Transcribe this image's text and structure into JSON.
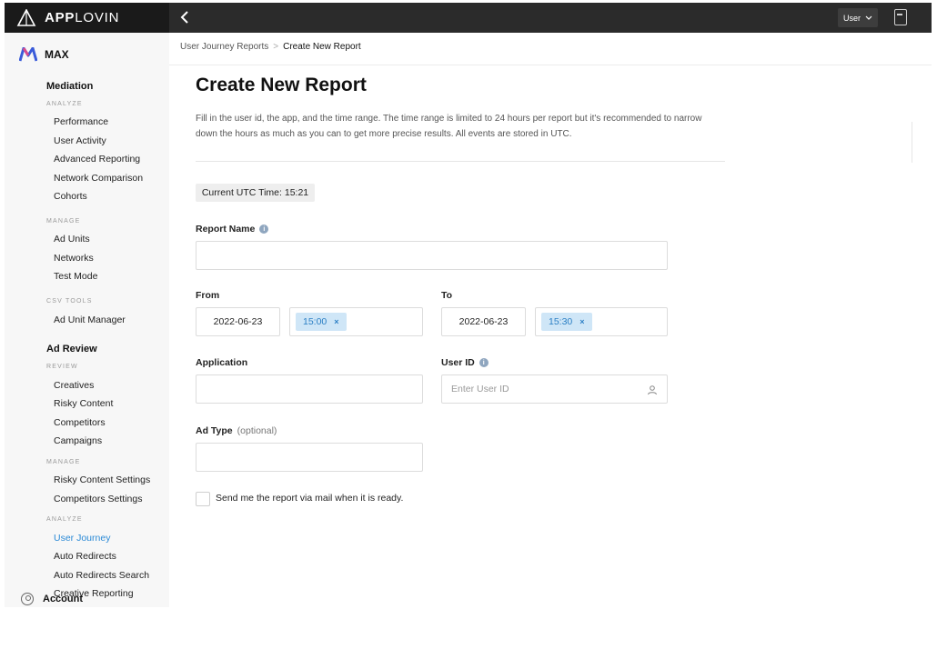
{
  "brand": {
    "name_bold": "APP",
    "name_rest": "LOVIN"
  },
  "topbar": {
    "user_label": "User"
  },
  "sidebar": {
    "product": "MAX",
    "mediation": {
      "title": "Mediation",
      "analyze_label": "ANALYZE",
      "analyze": [
        "Performance",
        "User Activity",
        "Advanced Reporting",
        "Network Comparison",
        "Cohorts"
      ],
      "manage_label": "MANAGE",
      "manage": [
        "Ad Units",
        "Networks",
        "Test Mode"
      ],
      "csv_label": "CSV TOOLS",
      "csv": [
        "Ad Unit Manager"
      ]
    },
    "ad_review": {
      "title": "Ad Review",
      "review_label": "REVIEW",
      "review": [
        "Creatives",
        "Risky Content",
        "Competitors",
        "Campaigns"
      ],
      "manage_label": "MANAGE",
      "manage": [
        "Risky Content Settings",
        "Competitors Settings"
      ],
      "analyze_label": "ANALYZE",
      "analyze": [
        "User Journey",
        "Auto Redirects",
        "Auto Redirects Search",
        "Creative Reporting"
      ],
      "active": "User Journey"
    },
    "account": "Account"
  },
  "breadcrumb": {
    "parent": "User Journey Reports",
    "separator": ">",
    "current": "Create New Report"
  },
  "page": {
    "title": "Create New Report",
    "description": "Fill in the user id, the app, and the time range. The time range is limited to 24 hours per report but it's recommended to narrow down the hours as much as you can to get more precise results. All events are stored in UTC.",
    "utc_time": "Current UTC Time: 15:21"
  },
  "form": {
    "report_name": {
      "label": "Report Name",
      "value": "",
      "placeholder": ""
    },
    "from": {
      "label": "From",
      "date": "2022-06-23",
      "time": "15:00"
    },
    "to": {
      "label": "To",
      "date": "2022-06-23",
      "time": "15:30"
    },
    "application": {
      "label": "Application",
      "value": ""
    },
    "user_id": {
      "label": "User ID",
      "placeholder": "Enter User ID"
    },
    "ad_type": {
      "label": "Ad Type",
      "optional": "(optional)",
      "value": ""
    },
    "send_mail": {
      "label": "Send me the report via mail when it is ready.",
      "checked": false
    },
    "chip_remove": "×"
  },
  "colors": {
    "accent": "#2b8ad6",
    "chip_bg": "#cfe6f7",
    "topbar": "#2b2b2b"
  },
  "icons": [
    "applovin-logo-icon",
    "max-logo-icon",
    "back-chevron-icon",
    "chevron-down-icon",
    "terminal-icon",
    "info-icon",
    "user-icon",
    "account-icon"
  ]
}
